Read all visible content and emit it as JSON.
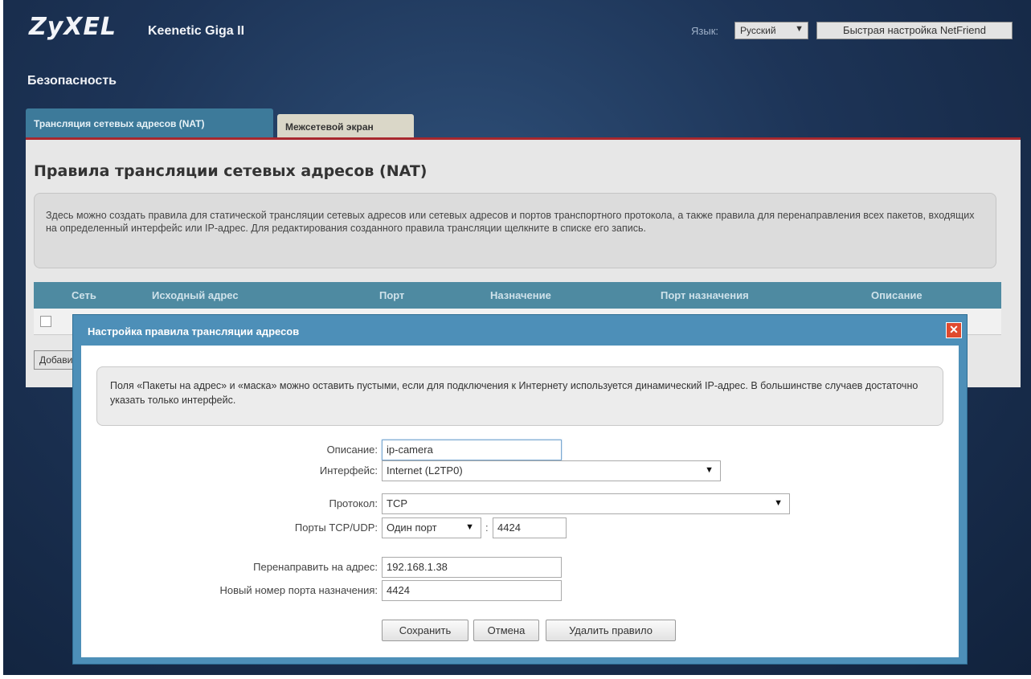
{
  "header": {
    "logo": "ZyXEL",
    "model": "Keenetic Giga II",
    "language_label": "Язык:",
    "language_value": "Русский",
    "quick_setup": "Быстрая настройка NetFriend"
  },
  "section_title": "Безопасность",
  "tabs": [
    {
      "label": "Трансляция сетевых адресов (NAT)",
      "active": true
    },
    {
      "label": "Межсетевой экран",
      "active": false
    }
  ],
  "panel": {
    "title": "Правила трансляции сетевых адресов (NAT)",
    "info": "Здесь можно создать правила для статической трансляции сетевых адресов или сетевых адресов и портов транспортного протокола, а также правила для перенаправления всех пакетов, входящих на определенный интерфейс или IP-адрес. Для редактирования созданного правила трансляции щелкните в списке его запись.",
    "columns": [
      "Сеть",
      "Исходный адрес",
      "Порт",
      "Назначение",
      "Порт назначения",
      "Описание"
    ],
    "add_button": "Добавить правило"
  },
  "dialog": {
    "title": "Настройка правила трансляции адресов",
    "close_icon": "close-icon",
    "note": "Поля «Пакеты на адрес» и «маска» можно оставить пустыми, если для подключения к Интернету используется динамический IP-адрес. В большинстве случаев достаточно указать только интерфейс.",
    "fields": {
      "description_label": "Описание:",
      "description_value": "ip-camera",
      "interface_label": "Интерфейс:",
      "interface_value": "Internet (L2TP0)",
      "protocol_label": "Протокол:",
      "protocol_value": "TCP",
      "ports_label": "Порты TCP/UDP:",
      "ports_mode": "Один порт",
      "ports_value": "4424",
      "redirect_label": "Перенаправить на адрес:",
      "redirect_value": "192.168.1.38",
      "new_port_label": "Новый номер порта назначения:",
      "new_port_value": "4424"
    },
    "buttons": {
      "save": "Сохранить",
      "cancel": "Отмена",
      "delete": "Удалить правило"
    }
  },
  "colors": {
    "background": "#1d3457",
    "tab_active": "#3d7a9a",
    "accent_line": "#a8282e",
    "dialog_frame": "#4d8fb8",
    "close_button": "#e04a2e"
  }
}
